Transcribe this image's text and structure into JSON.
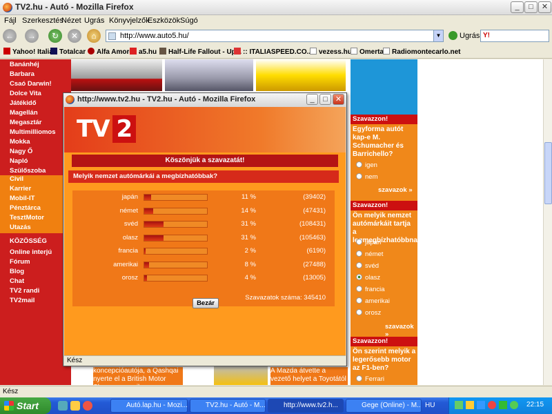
{
  "window": {
    "title": "TV2.hu - Autó - Mozilla Firefox",
    "min": "_",
    "max": "□",
    "close": "✕"
  },
  "menu": [
    "Fájl",
    "Szerkesztés",
    "Nézet",
    "Ugrás",
    "Könyvjelzők",
    "Eszközök",
    "Súgó"
  ],
  "nav": {
    "url": "http://www.auto5.hu/",
    "go_label": "Ugrás",
    "back": "←",
    "forward": "→",
    "reload": "↻",
    "stop": "✕",
    "home": "⌂"
  },
  "bookmarks": [
    "Yahoo! Italia",
    "Totalcar",
    "Alfa Amore",
    "a5.hu",
    "Half-Life Fallout - Up...",
    ":: ITALIASPEED.CO...",
    "vezess.hu",
    "Omerta",
    "Radiomontecarlo.net"
  ],
  "leftnav": {
    "items": [
      "Banánhéj",
      "Barbara",
      "Csaó Darwin!",
      "Dolce Vita",
      "Játékidő",
      "Magellán",
      "Megasztár",
      "Multimilliomos",
      "Mokka",
      "Nagy Ő",
      "Napló",
      "Szülőszoba"
    ],
    "orange": [
      "Civil",
      "Karrier",
      "Mobil-IT",
      "Pénztárca",
      "TesztMotor",
      "Utazás"
    ],
    "section": "KÖZÖSSÉG",
    "community": [
      "Online interjú",
      "Fórum",
      "Blog",
      "Chat",
      "TV2 randi",
      "TV2mail"
    ]
  },
  "right": {
    "poll1": {
      "head": "Szavazzon!",
      "question": "Egyforma autót kap-e M. Schumacher és Barrichello?",
      "options": [
        "igen",
        "nem"
      ],
      "link": "szavazok »"
    },
    "poll2": {
      "head": "Szavazzon!",
      "question": "Ön melyik nemzet autómárkáit tartja a legmegbízhatóbbnak?",
      "options": [
        "japán",
        "német",
        "svéd",
        "olasz",
        "francia",
        "amerikai",
        "orosz"
      ],
      "selected": "olasz",
      "link": "szavazok »"
    },
    "poll3": {
      "head": "Szavazzon!",
      "question": "Ön szerint melyik a legerősebb motor az F1-ben?",
      "options": [
        "Ferrari"
      ]
    }
  },
  "bottom_text": {
    "left": "koncepcióautója, a Qashqai nyerte el a British Motor Shown az egyik",
    "right": "A Mazda átvette a vezető helyet a Toyotától az"
  },
  "statusbar": "Kész",
  "popup": {
    "title": "http://www.tv2.hu - TV2.hu - Autó - Mozilla Firefox",
    "logo_tv": "TV",
    "logo_num": "2",
    "thanks": "Köszönjük a szavazatát!",
    "question": "Melyik nemzet autómárkái a megbízhatóbbak?",
    "results": [
      {
        "label": "japán",
        "percent": 11,
        "pct_text": "11 %",
        "votes": "(39402)"
      },
      {
        "label": "német",
        "percent": 14,
        "pct_text": "14 %",
        "votes": "(47431)"
      },
      {
        "label": "svéd",
        "percent": 31,
        "pct_text": "31 %",
        "votes": "(108431)"
      },
      {
        "label": "olasz",
        "percent": 31,
        "pct_text": "31 %",
        "votes": "(105463)"
      },
      {
        "label": "francia",
        "percent": 2,
        "pct_text": "2 %",
        "votes": "(6190)"
      },
      {
        "label": "amerikai",
        "percent": 8,
        "pct_text": "8 %",
        "votes": "(27488)"
      },
      {
        "label": "orosz",
        "percent": 4,
        "pct_text": "4 %",
        "votes": "(13005)"
      }
    ],
    "total": "Szavazatok száma: 345410",
    "close_button": "Bezár",
    "status": "Kész"
  },
  "taskbar": {
    "start": "Start",
    "tasks": [
      "Autó.lap.hu - Mozi...",
      "TV2.hu - Autó - M...",
      "http://www.tv2.h...",
      "Gege (Online) - M..."
    ],
    "lang": "HU",
    "clock": "22:15"
  },
  "colors": {
    "tv2_red": "#cc1010",
    "tv2_orange": "#f07818",
    "bar_fill": "#c01a10"
  }
}
